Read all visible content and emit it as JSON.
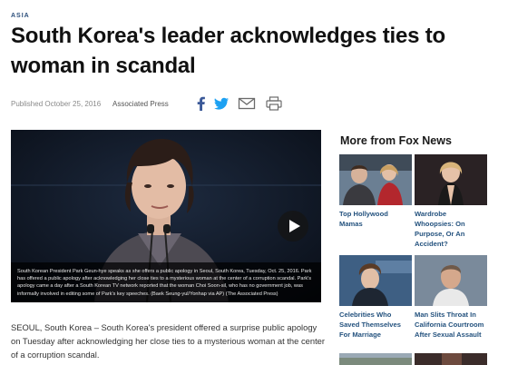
{
  "article": {
    "section": "ASIA",
    "headline": "South Korea's leader acknowledges ties to woman in scandal",
    "published_label": "Published October 25, 2016",
    "source": "Associated Press",
    "share_icons": [
      "facebook-icon",
      "twitter-icon",
      "email-icon",
      "print-icon"
    ],
    "video_caption": "South Korean President Park Geun-hye speaks as she offers a public apology in Seoul, South Korea, Tuesday, Oct. 25, 2016. Park has offered a public apology after acknowledging her close ties to a mysterious woman at the center of a corruption scandal. Park's apology came a day after a South Korean TV network reported that the woman Choi Soon-sil, who has no government job, was informally involved in editing some of Park's key speeches. (Baek Seung-yul/Yonhap via AP) (The Associated Press)",
    "body": "SEOUL, South Korea –  South Korea's president offered a surprise public apology on Tuesday after acknowledging her close ties to a mysterious woman at the center of a corruption scandal."
  },
  "sidebar": {
    "title": "More from Fox News",
    "items": [
      {
        "title": "Top Hollywood Mamas"
      },
      {
        "title": "Wardrobe Whoopsies: On Purpose, Or An Accident?"
      },
      {
        "title": "Celebrities Who Saved Themselves For Marriage"
      },
      {
        "title": "Man Slits Throat In California Courtroom After Sexual Assault"
      }
    ]
  },
  "colors": {
    "link_blue": "#24527e",
    "facebook": "#3b5998",
    "twitter": "#1da1f2",
    "section_tag": "#2a4d7a"
  }
}
